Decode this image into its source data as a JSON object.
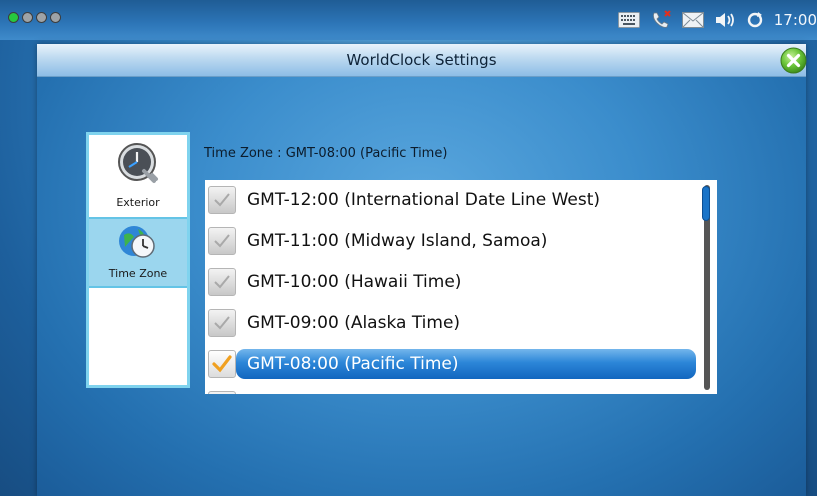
{
  "status_bar": {
    "time": "17:00",
    "indicator_dots": 4,
    "icons": [
      "keyboard-icon",
      "missed-call-icon",
      "mail-icon",
      "volume-icon",
      "sync-icon"
    ]
  },
  "dialog": {
    "title": "WorldClock Settings",
    "close_icon": "close-icon"
  },
  "sidebar": {
    "items": [
      {
        "label": "Exterior",
        "icon": "clock-wrench-icon",
        "selected": false
      },
      {
        "label": "Time Zone",
        "icon": "globe-clock-icon",
        "selected": true
      }
    ]
  },
  "timezone": {
    "label": "Time Zone : GMT-08:00 (Pacific Time)",
    "options": [
      {
        "label": "GMT-12:00 (International Date Line West)",
        "checked": false
      },
      {
        "label": "GMT-11:00 (Midway Island, Samoa)",
        "checked": false
      },
      {
        "label": "GMT-10:00 (Hawaii Time)",
        "checked": false
      },
      {
        "label": "GMT-09:00 (Alaska Time)",
        "checked": false
      },
      {
        "label": "GMT-08:00 (Pacific Time)",
        "checked": true
      }
    ]
  },
  "colors": {
    "selection": "#1e78cf",
    "check_orange": "#f0a020",
    "sidebar_border": "#7fd3ee"
  }
}
